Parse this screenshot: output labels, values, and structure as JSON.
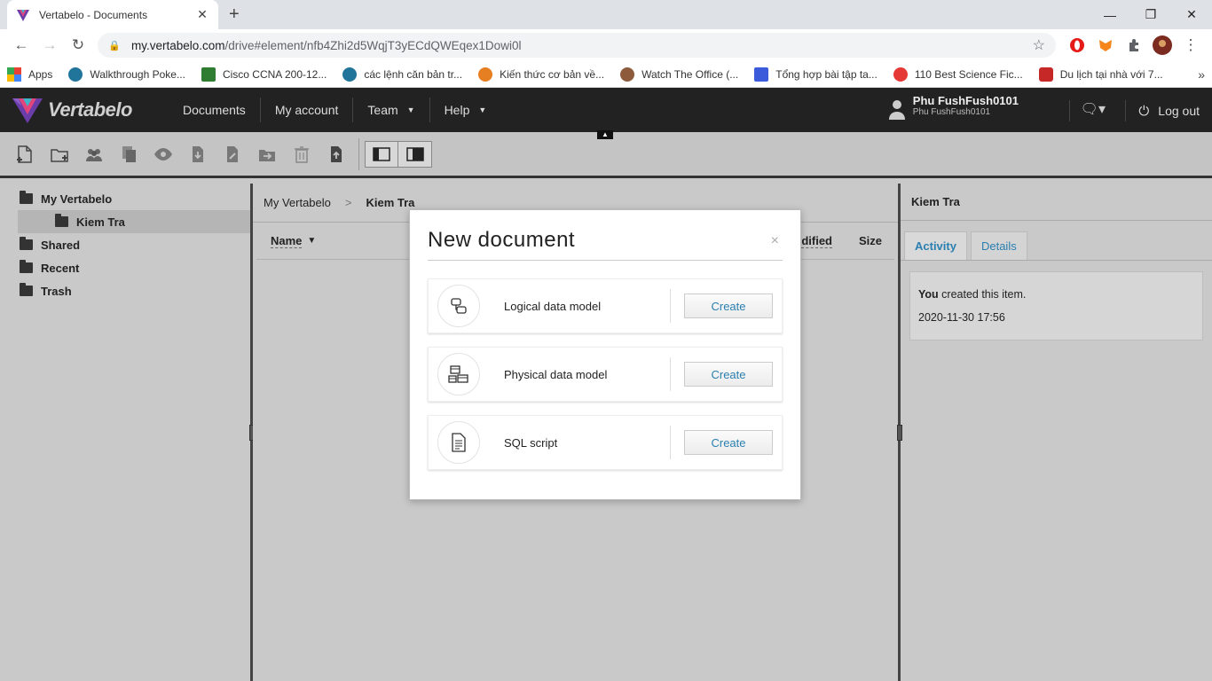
{
  "browser": {
    "tab_title": "Vertabelo - Documents",
    "tab_close": "✕",
    "new_tab": "+",
    "url_host": "my.vertabelo.com",
    "url_path": "/drive#element/nfb4Zhi2d5WqjT3yECdQWEqex1Dowi0l",
    "bookmarks": [
      {
        "label": "Apps",
        "color": "#e94235"
      },
      {
        "label": "Walkthrough Poke...",
        "color": "#21759b"
      },
      {
        "label": "Cisco CCNA 200-12...",
        "color": "#2e7d32"
      },
      {
        "label": "các lệnh căn bản tr...",
        "color": "#21759b"
      },
      {
        "label": "Kiến thức cơ bản về...",
        "color": "#e67e22"
      },
      {
        "label": "Watch The Office (...",
        "color": "#8d5a3b"
      },
      {
        "label": "Tổng hợp bài tập ta...",
        "color": "#3b5bdb"
      },
      {
        "label": "110 Best Science Fic...",
        "color": "#e53935"
      },
      {
        "label": "Du lịch tại nhà với 7...",
        "color": "#c62828"
      }
    ],
    "bookmarks_more": "»"
  },
  "app": {
    "brand": "Vertabelo",
    "nav": [
      {
        "label": "Documents"
      },
      {
        "label": "My account"
      },
      {
        "label": "Team",
        "dropdown": true
      },
      {
        "label": "Help",
        "dropdown": true
      }
    ],
    "user_name": "Phu FushFush0101",
    "user_login": "Phu FushFush0101",
    "logout_label": "Log out"
  },
  "tree": {
    "items": [
      {
        "label": "My Vertabelo"
      },
      {
        "label": "Kiem Tra"
      },
      {
        "label": "Shared"
      },
      {
        "label": "Recent"
      },
      {
        "label": "Trash"
      }
    ]
  },
  "center": {
    "breadcrumb_root": "My Vertabelo",
    "breadcrumb_sep": ">",
    "breadcrumb_current": "Kiem Tra",
    "col_name": "Name",
    "col_modified": "dified",
    "col_size": "Size"
  },
  "right": {
    "title": "Kiem Tra",
    "tab_activity": "Activity",
    "tab_details": "Details",
    "activity_actor": "You",
    "activity_text": " created this item.",
    "activity_time": "2020-11-30 17:56"
  },
  "modal": {
    "title": "New document",
    "close": "×",
    "options": [
      {
        "label": "Logical data model",
        "button": "Create",
        "icon": "logical-model-icon"
      },
      {
        "label": "Physical data model",
        "button": "Create",
        "icon": "physical-model-icon"
      },
      {
        "label": "SQL script",
        "button": "Create",
        "icon": "sql-script-icon"
      }
    ]
  },
  "colors": {
    "header_bg": "#222222",
    "link_blue": "#2b7fb0",
    "pane_bg": "#c9c9c9"
  }
}
